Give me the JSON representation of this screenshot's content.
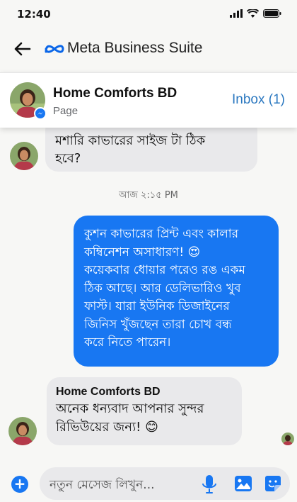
{
  "status_bar": {
    "time": "12:40"
  },
  "app_header": {
    "title": "Meta Business Suite"
  },
  "page": {
    "name": "Home Comforts BD",
    "type": "Page",
    "inbox_label": "Inbox (1)"
  },
  "messages": {
    "incoming_1_lines": [
      "মশারি কাভারের সাইজ টা ঠিক",
      "হবে?"
    ],
    "timestamp": "আজ ২:১৫ PM",
    "outgoing_lines": [
      "কুশন কাভারের প্রিন্ট এবং কালার",
      "কম্বিনেশন অসাধারণ! 😍",
      "কয়েকবার ধোয়ার পরেও রঙ একম",
      "ঠিক আছে। আর ডেলিভারিও খুব",
      "ফাস্ট। যারা ইউনিক ডিজাইনের",
      "জিনিস খুঁজছেন তারা চোখ বন্ধ",
      "করে নিতে পারেন।"
    ],
    "incoming_2_sender": "Home Comforts BD",
    "incoming_2_lines": [
      "অনেক ধন্যবাদ আপনার সুন্দর",
      "রিভিউয়ের জন্য! 😊"
    ]
  },
  "composer": {
    "placeholder": "নতুন মেসেজ লিখুন..."
  },
  "colors": {
    "accent": "#1877f2",
    "inbox_link": "#2b78c0",
    "incoming_bubble": "#e9e9eb"
  },
  "icons": [
    "back-arrow-icon",
    "meta-logo-icon",
    "messenger-badge-icon",
    "plus-icon",
    "microphone-icon",
    "photo-icon",
    "sticker-icon"
  ]
}
